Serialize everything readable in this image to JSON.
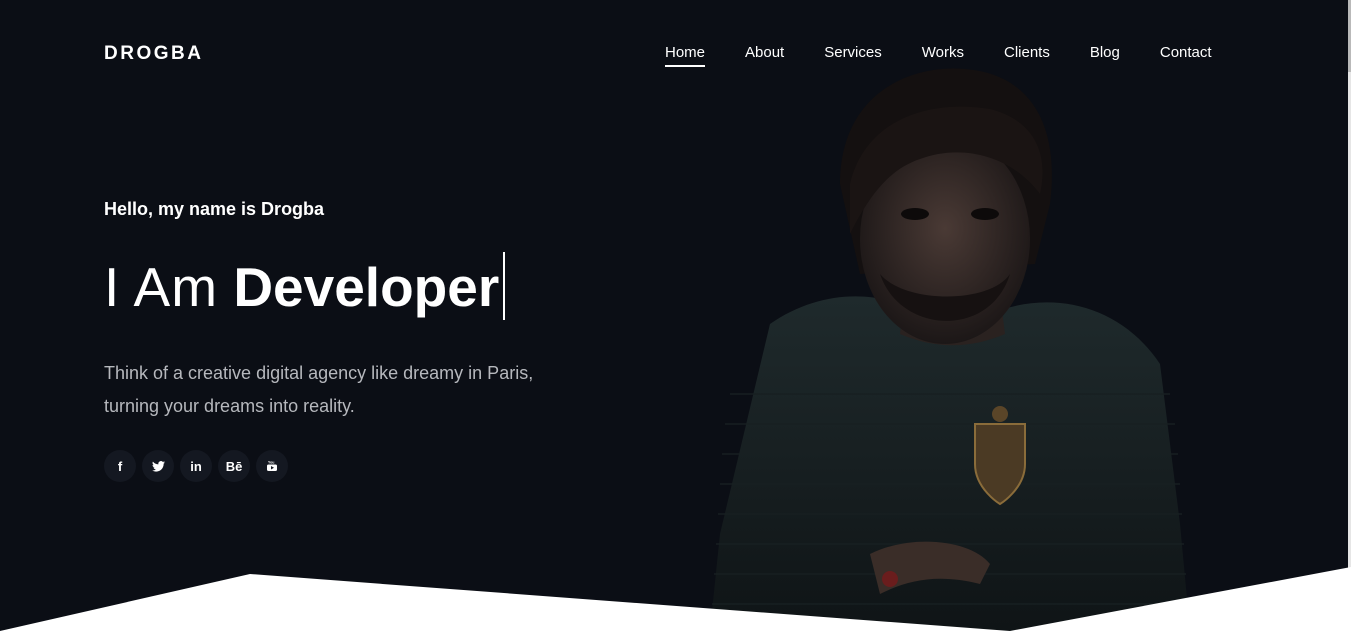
{
  "brand": "DROGBA",
  "nav": {
    "items": [
      "Home",
      "About",
      "Services",
      "Works",
      "Clients",
      "Blog",
      "Contact"
    ],
    "active": "Home"
  },
  "hero": {
    "greeting": "Hello, my name is Drogba",
    "headline_light": "I Am",
    "headline_bold": "Developer",
    "description_line1": "Think of a creative digital agency like dreamy in Paris,",
    "description_line2": "turning your dreams into reality."
  },
  "social": [
    {
      "icon": "facebook-icon",
      "glyph": "f"
    },
    {
      "icon": "twitter-icon",
      "glyph": "🐦"
    },
    {
      "icon": "linkedin-icon",
      "glyph": "in"
    },
    {
      "icon": "behance-icon",
      "glyph": "Bē"
    },
    {
      "icon": "youtube-icon",
      "glyph": "▶"
    }
  ],
  "colors": {
    "background": "#0b0e15",
    "text": "#ffffff",
    "muted_text": "#b6b8bd",
    "social_bg": "#141821"
  }
}
